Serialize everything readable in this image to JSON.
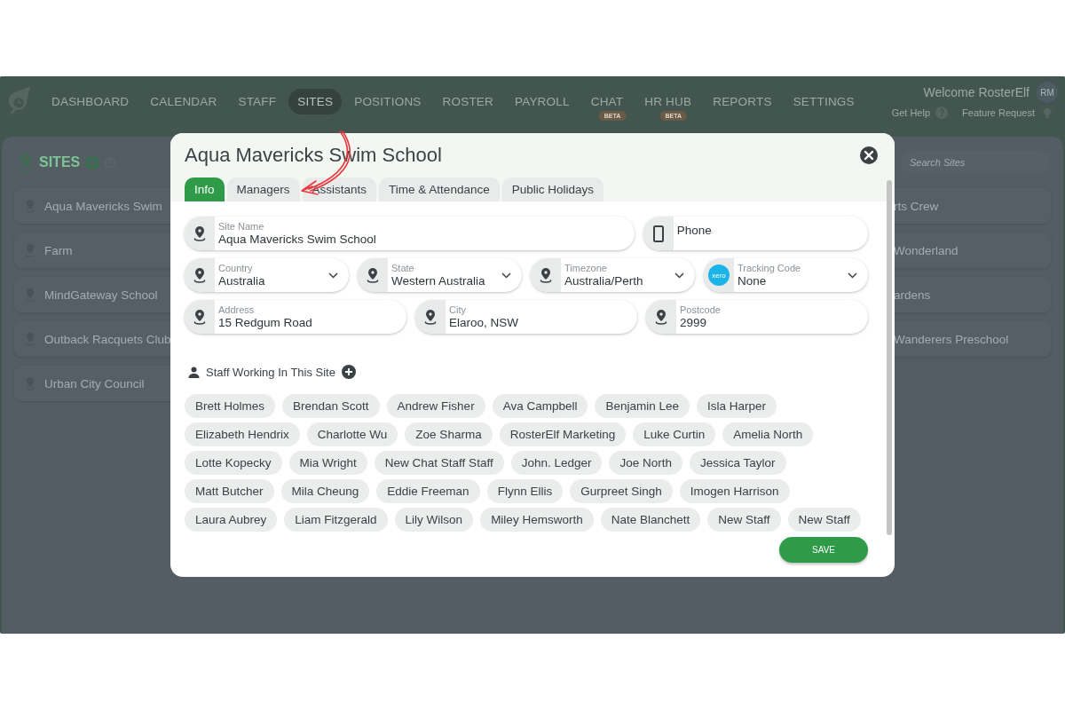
{
  "nav": {
    "items": [
      {
        "label": "DASHBOARD",
        "selected": false
      },
      {
        "label": "CALENDAR",
        "selected": false
      },
      {
        "label": "STAFF",
        "selected": false
      },
      {
        "label": "SITES",
        "selected": true
      },
      {
        "label": "POSITIONS",
        "selected": false
      },
      {
        "label": "ROSTER",
        "selected": false
      },
      {
        "label": "PAYROLL",
        "selected": false
      },
      {
        "label": "CHAT",
        "selected": false,
        "badge": "BETA"
      },
      {
        "label": "HR HUB",
        "selected": false,
        "badge": "BETA"
      },
      {
        "label": "REPORTS",
        "selected": false
      },
      {
        "label": "SETTINGS",
        "selected": false
      }
    ],
    "welcome": "Welcome RosterElf",
    "avatar": "RM",
    "help": "Get Help",
    "feature_request": "Feature Request"
  },
  "sites_panel": {
    "title": "SITES",
    "search": {
      "placeholder": "Search Sites"
    },
    "left_sites": [
      {
        "label": "Aqua Mavericks Swim"
      },
      {
        "label": "Farm"
      },
      {
        "label": "MindGateway School"
      },
      {
        "label": "Outback Racquets Club"
      },
      {
        "label": "Urban City Council"
      }
    ],
    "right_sites": [
      {
        "label": "rts Crew"
      },
      {
        "label": "Wonderland"
      },
      {
        "label": "ardens"
      },
      {
        "label": "Wanderers Preschool"
      }
    ]
  },
  "modal": {
    "title": "Aqua Mavericks Swim School",
    "tabs": [
      {
        "label": "Info",
        "selected": true
      },
      {
        "label": "Managers",
        "selected": false
      },
      {
        "label": "Assistants",
        "selected": false
      },
      {
        "label": "Time & Attendance",
        "selected": false
      },
      {
        "label": "Public Holidays",
        "selected": false
      }
    ],
    "field_rows": [
      [
        {
          "kind": "text",
          "label": "Site Name",
          "value": "Aqua Mavericks Swim School"
        },
        {
          "kind": "phone",
          "placeholder": "Phone"
        }
      ],
      [
        {
          "kind": "select",
          "label": "Country",
          "value": "Australia"
        },
        {
          "kind": "select",
          "label": "State",
          "value": "Western Australia"
        },
        {
          "kind": "select",
          "label": "Timezone",
          "value": "Australia/Perth"
        },
        {
          "kind": "tracking",
          "logo": "xero",
          "label": "Tracking Code",
          "value": "None"
        }
      ],
      [
        {
          "kind": "text",
          "label": "Address",
          "value": "15 Redgum Road"
        },
        {
          "kind": "text",
          "label": "City",
          "value": "Elaroo, NSW"
        },
        {
          "kind": "text",
          "label": "Postcode",
          "value": "2999"
        }
      ]
    ],
    "staff_heading": "Staff Working In This Site",
    "staff": [
      "Brett Holmes",
      "Brendan Scott",
      "Andrew Fisher",
      "Ava Campbell",
      "Benjamin Lee",
      "Isla Harper",
      "Elizabeth Hendrix",
      "Charlotte Wu",
      "Zoe Sharma",
      "RosterElf Marketing",
      "Luke Curtin",
      "Amelia North",
      "Lotte Kopecky",
      "Mia Wright",
      "New Chat Staff Staff",
      "John. Ledger",
      "Joe North",
      "Jessica Taylor",
      "Matt Butcher",
      "Mila Cheung",
      "Eddie Freeman",
      "Flynn Ellis",
      "Gurpreet Singh",
      "Imogen Harrison",
      "Laura Aubrey",
      "Liam Fitzgerald",
      "Lily Wilson",
      "Miley Hemsworth",
      "Nate Blanchett",
      "New Staff",
      "New Staff"
    ],
    "save": "SAVE"
  }
}
